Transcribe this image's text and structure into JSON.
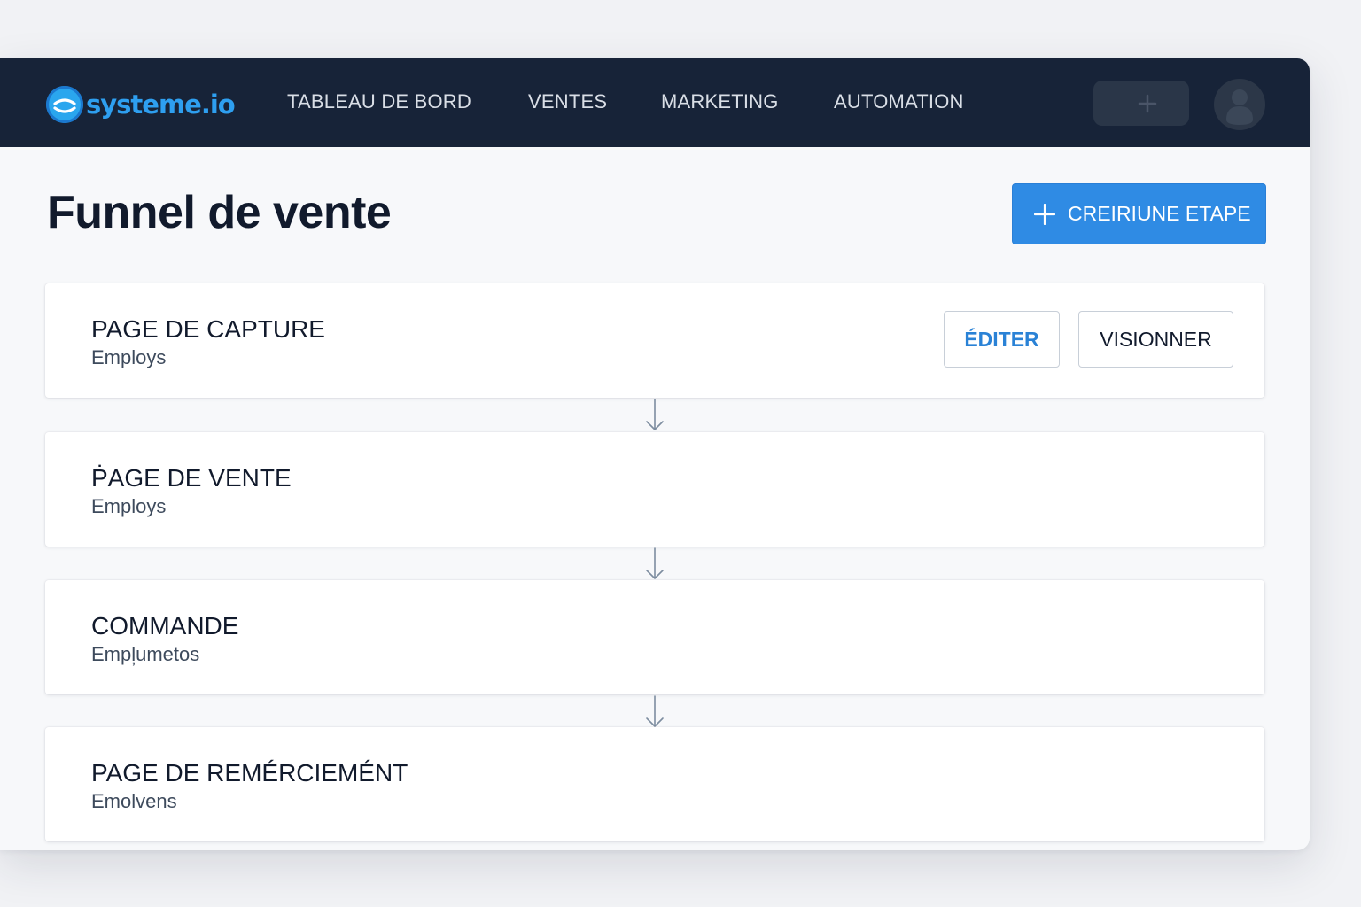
{
  "brand": {
    "name": "systeme.io"
  },
  "nav": {
    "items": [
      {
        "label": "TABLEAU DE BORD"
      },
      {
        "label": "VENTES"
      },
      {
        "label": "MARKETING"
      },
      {
        "label": "AUTOMATION"
      }
    ],
    "add_icon": "plus-icon",
    "avatar_icon": "user-avatar-icon"
  },
  "page": {
    "title": "Funnel de vente",
    "create_button_label": "CREIRIUNE ETAPE"
  },
  "steps": [
    {
      "title": "PAGE DE CAPTURE",
      "subtitle": "Employs",
      "edit_label": "ÉDITER",
      "view_label": "VISIONNER"
    },
    {
      "title": "ṖAGE DE VENTE",
      "subtitle": "Employs"
    },
    {
      "title": "COMMANDE",
      "subtitle": "Empl̦umetos"
    },
    {
      "title": "PAGE DE REMÉRCIEMÉNT",
      "subtitle": "Emolvens"
    }
  ],
  "colors": {
    "topbar": "#172338",
    "brand_blue": "#2e9ff0",
    "primary_button": "#2f8be4",
    "edit_text": "#2a82d6",
    "page_background": "#f7f8fa"
  }
}
